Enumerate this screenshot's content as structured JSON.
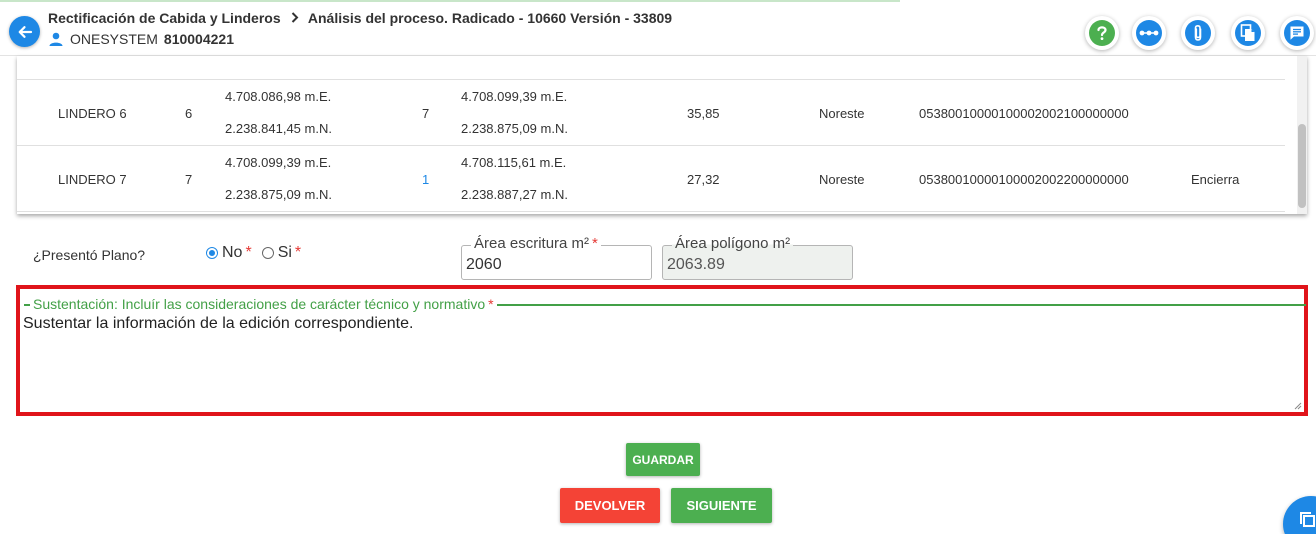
{
  "header": {
    "breadcrumb_1": "Rectificación de Cabida y Linderos",
    "breadcrumb_2": "Análisis del proceso. Radicado - 10660 Versión - 33809",
    "user_name": "ONESYSTEM",
    "user_id": "810004221",
    "actions": [
      "help-icon",
      "flow-icon",
      "attachment-icon",
      "copy-document-icon",
      "comments-icon"
    ]
  },
  "table": {
    "rows": [
      {
        "name": "LINDERO 6",
        "from": "6",
        "from_e": "4.708.086,98 m.E.",
        "from_n": "2.238.841,45 m.N.",
        "to": "7",
        "to_e": "4.708.099,39 m.E.",
        "to_n": "2.238.875,09 m.N.",
        "distance": "35,85",
        "direction": "Noreste",
        "predio": "05380010000100002002100000000",
        "obs": ""
      },
      {
        "name": "LINDERO 7",
        "from": "7",
        "from_e": "4.708.099,39 m.E.",
        "from_n": "2.238.875,09 m.N.",
        "to": "1",
        "to_e": "4.708.115,61 m.E.",
        "to_n": "2.238.887,27 m.N.",
        "distance": "27,32",
        "direction": "Noreste",
        "predio": "05380010000100002002200000000",
        "obs": "Encierra"
      }
    ]
  },
  "form": {
    "plano_label": "¿Presentó Plano?",
    "option_no": "No",
    "option_si": "Si",
    "required_mark": "*",
    "area_escritura_label": "Área escritura m²",
    "area_escritura_value": "2060",
    "area_poligono_label": "Área polígono m²",
    "area_poligono_value": "2063.89",
    "sustentacion_label": "Sustentación: Incluír las consideraciones de carácter técnico y normativo",
    "sustentacion_value": "Sustentar la información de la edición correspondiente."
  },
  "buttons": {
    "guardar": "GUARDAR",
    "devolver": "DEVOLVER",
    "siguiente": "SIGUIENTE"
  },
  "colors": {
    "primary": "#1e88e5",
    "success": "#4caf50",
    "danger": "#f44336",
    "highlight": "#e0141a"
  }
}
